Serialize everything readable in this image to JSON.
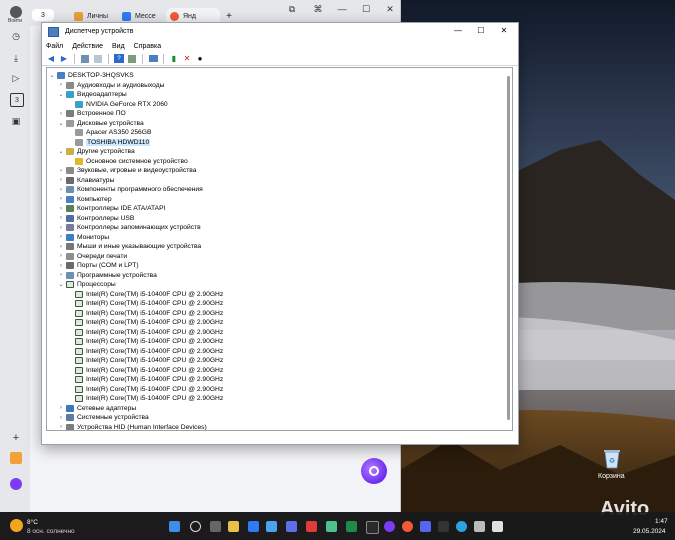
{
  "browser": {
    "tab_count": "3",
    "tabs": [
      {
        "label": "Личны",
        "color": "#e7a23a"
      },
      {
        "label": "Мессе",
        "color": "#2f7bf5"
      },
      {
        "label": "Янд",
        "color": "#f15a35"
      }
    ],
    "new_tab": "+",
    "profile_label": "Войти",
    "sidebar_badge": "3"
  },
  "device_manager": {
    "title": "Диспетчер устройств",
    "menu": [
      "Файл",
      "Действие",
      "Вид",
      "Справка"
    ],
    "window_controls": {
      "minimize": "—",
      "maximize": "☐",
      "close": "✕"
    },
    "tree": [
      {
        "indent": 0,
        "expander": "v",
        "icon": "computer",
        "label": "DESKTOP-3HQSVKS"
      },
      {
        "indent": 1,
        "expander": ">",
        "icon": "audio",
        "label": "Аудиовходы и аудиовыходы"
      },
      {
        "indent": 1,
        "expander": "v",
        "icon": "display",
        "label": "Видеоадаптеры"
      },
      {
        "indent": 2,
        "expander": "",
        "icon": "display",
        "label": "NVIDIA GeForce RTX 2060"
      },
      {
        "indent": 1,
        "expander": ">",
        "icon": "firmware",
        "label": "Встроенное ПО"
      },
      {
        "indent": 1,
        "expander": "v",
        "icon": "disk",
        "label": "Дисковые устройства"
      },
      {
        "indent": 2,
        "expander": "",
        "icon": "disk",
        "label": "Apacer AS350 256GB"
      },
      {
        "indent": 2,
        "expander": "",
        "icon": "disk",
        "label": "TOSHIBA HDWD110",
        "selected": true
      },
      {
        "indent": 1,
        "expander": "v",
        "icon": "other",
        "label": "Другие устройства"
      },
      {
        "indent": 2,
        "expander": "",
        "icon": "warning",
        "label": "Основное системное устройство"
      },
      {
        "indent": 1,
        "expander": ">",
        "icon": "audio",
        "label": "Звуковые, игровые и видеоустройства"
      },
      {
        "indent": 1,
        "expander": ">",
        "icon": "keyboard",
        "label": "Клавиатуры"
      },
      {
        "indent": 1,
        "expander": ">",
        "icon": "software",
        "label": "Компоненты программного обеспечения"
      },
      {
        "indent": 1,
        "expander": ">",
        "icon": "computer",
        "label": "Компьютер"
      },
      {
        "indent": 1,
        "expander": ">",
        "icon": "ide",
        "label": "Контроллеры IDE ATA/ATAPI"
      },
      {
        "indent": 1,
        "expander": ">",
        "icon": "usb",
        "label": "Контроллеры USB"
      },
      {
        "indent": 1,
        "expander": ">",
        "icon": "storage",
        "label": "Контроллеры запоминающих устройств"
      },
      {
        "indent": 1,
        "expander": ">",
        "icon": "monitor",
        "label": "Мониторы"
      },
      {
        "indent": 1,
        "expander": ">",
        "icon": "mouse",
        "label": "Мыши и иные указывающие устройства"
      },
      {
        "indent": 1,
        "expander": ">",
        "icon": "printer",
        "label": "Очереди печати"
      },
      {
        "indent": 1,
        "expander": ">",
        "icon": "port",
        "label": "Порты (COM и LPT)"
      },
      {
        "indent": 1,
        "expander": ">",
        "icon": "software",
        "label": "Программные устройства"
      },
      {
        "indent": 1,
        "expander": "v",
        "icon": "cpu",
        "label": "Процессоры"
      },
      {
        "indent": 2,
        "expander": "",
        "icon": "cpu",
        "label": "Intel(R) Core(TM) i5-10400F CPU @ 2.90GHz"
      },
      {
        "indent": 2,
        "expander": "",
        "icon": "cpu",
        "label": "Intel(R) Core(TM) i5-10400F CPU @ 2.90GHz"
      },
      {
        "indent": 2,
        "expander": "",
        "icon": "cpu",
        "label": "Intel(R) Core(TM) i5-10400F CPU @ 2.90GHz"
      },
      {
        "indent": 2,
        "expander": "",
        "icon": "cpu",
        "label": "Intel(R) Core(TM) i5-10400F CPU @ 2.90GHz"
      },
      {
        "indent": 2,
        "expander": "",
        "icon": "cpu",
        "label": "Intel(R) Core(TM) i5-10400F CPU @ 2.90GHz"
      },
      {
        "indent": 2,
        "expander": "",
        "icon": "cpu",
        "label": "Intel(R) Core(TM) i5-10400F CPU @ 2.90GHz"
      },
      {
        "indent": 2,
        "expander": "",
        "icon": "cpu",
        "label": "Intel(R) Core(TM) i5-10400F CPU @ 2.90GHz"
      },
      {
        "indent": 2,
        "expander": "",
        "icon": "cpu",
        "label": "Intel(R) Core(TM) i5-10400F CPU @ 2.90GHz"
      },
      {
        "indent": 2,
        "expander": "",
        "icon": "cpu",
        "label": "Intel(R) Core(TM) i5-10400F CPU @ 2.90GHz"
      },
      {
        "indent": 2,
        "expander": "",
        "icon": "cpu",
        "label": "Intel(R) Core(TM) i5-10400F CPU @ 2.90GHz"
      },
      {
        "indent": 2,
        "expander": "",
        "icon": "cpu",
        "label": "Intel(R) Core(TM) i5-10400F CPU @ 2.90GHz"
      },
      {
        "indent": 2,
        "expander": "",
        "icon": "cpu",
        "label": "Intel(R) Core(TM) i5-10400F CPU @ 2.90GHz"
      },
      {
        "indent": 1,
        "expander": ">",
        "icon": "network",
        "label": "Сетевые адаптеры"
      },
      {
        "indent": 1,
        "expander": ">",
        "icon": "system",
        "label": "Системные устройства"
      },
      {
        "indent": 1,
        "expander": ">",
        "icon": "hid",
        "label": "Устройства HID (Human Interface Devices)"
      }
    ]
  },
  "desktop": {
    "recycle_bin_label": "Корзина",
    "watermark": "Avito"
  },
  "taskbar": {
    "weather_temp": "8°C",
    "weather_desc": "8 осн. солнечно",
    "time": "1:47",
    "date": "29.05.2024"
  },
  "colors": {
    "selection": "#cce8ff",
    "folder_blue": "#4a7fc1",
    "taskbar_bg": "#19191c"
  }
}
